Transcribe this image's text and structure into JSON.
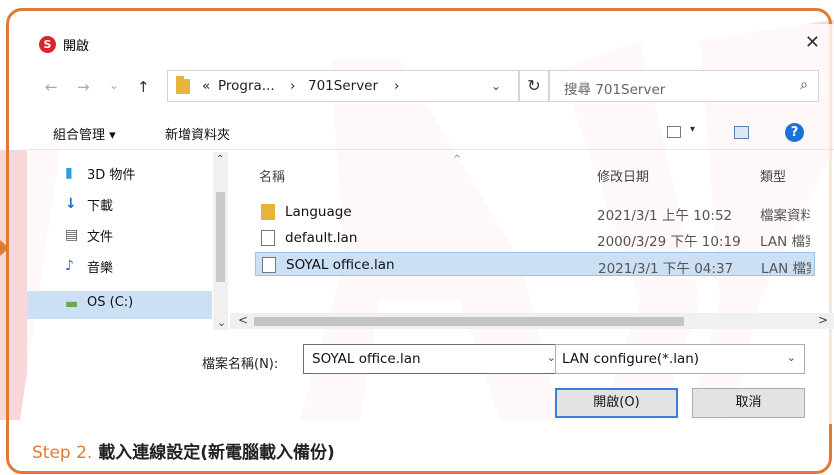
{
  "window": {
    "title": "開啟",
    "app_icon_letter": "S",
    "close_glyph": "✕"
  },
  "nav": {
    "back": "←",
    "forward": "→",
    "history": "⌄",
    "up": "↑",
    "breadcrumb": [
      "«",
      "Progra...",
      "›",
      "701Server",
      "›"
    ],
    "dropdown": "⌄",
    "refresh": "↻",
    "search_placeholder": "搜尋 701Server",
    "search_icon": "⌕"
  },
  "toolbar": {
    "organize": "組合管理 ▾",
    "new_folder": "新增資料夾",
    "view_caret": "▾",
    "help": "?"
  },
  "sidebar": {
    "items": [
      {
        "label": "3D 物件",
        "icon": "cube-icon",
        "glyph": "▮",
        "color": "#2c9ed8"
      },
      {
        "label": "下載",
        "icon": "download-icon",
        "glyph": "↓",
        "color": "#1f6fd1"
      },
      {
        "label": "文件",
        "icon": "document-icon",
        "glyph": "▤",
        "color": "#555555"
      },
      {
        "label": "音樂",
        "icon": "music-icon",
        "glyph": "♪",
        "color": "#1f6fd1"
      },
      {
        "label": "OS (C:)",
        "icon": "drive-icon",
        "glyph": "▬",
        "color": "#6aa84f"
      }
    ],
    "scroll_up": "⌃",
    "scroll_down": "⌄"
  },
  "files": {
    "columns": [
      "名稱",
      "修改日期",
      "類型"
    ],
    "rows": [
      {
        "name": "Language",
        "date": "2021/3/1 上午 10:52",
        "type": "檔案資料夾",
        "kind": "folder"
      },
      {
        "name": "default.lan",
        "date": "2000/3/29 下午 10:19",
        "type": "LAN 檔案",
        "kind": "file"
      },
      {
        "name": "SOYAL office.lan",
        "date": "2021/3/1 下午 04:37",
        "type": "LAN 檔案",
        "kind": "file"
      }
    ],
    "scroll_left": "<",
    "scroll_right": ">"
  },
  "footer": {
    "filename_label": "檔案名稱(N):",
    "filename_value": "SOYAL office.lan",
    "filter_value": "LAN configure(*.lan)",
    "open_button": "開啟(O)",
    "cancel_button": "取消",
    "caret": "⌄"
  },
  "caption": {
    "step": "Step 2.",
    "text": "載入連線設定(新電腦載入備份)"
  },
  "colors": {
    "accent": "#e07a36",
    "selection": "#cce0f5",
    "watermark": "#f3c6c6"
  }
}
